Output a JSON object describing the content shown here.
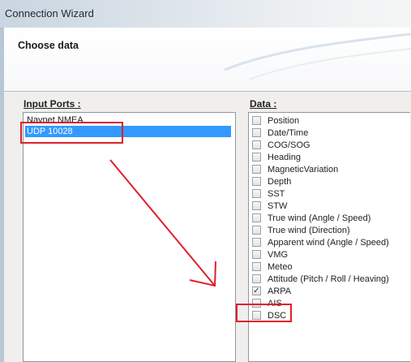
{
  "window": {
    "title": "Connection Wizard"
  },
  "header": {
    "title": "Choose data"
  },
  "ports": {
    "label": "Input Ports :",
    "items": [
      {
        "label": "Navnet NMEA",
        "selected": false
      },
      {
        "label": "UDP 10028",
        "selected": true
      }
    ]
  },
  "data_list": {
    "label": "Data :",
    "items": [
      {
        "label": "Position",
        "checked": false
      },
      {
        "label": "Date/Time",
        "checked": false
      },
      {
        "label": "COG/SOG",
        "checked": false
      },
      {
        "label": "Heading",
        "checked": false
      },
      {
        "label": "MagneticVariation",
        "checked": false
      },
      {
        "label": "Depth",
        "checked": false
      },
      {
        "label": "SST",
        "checked": false
      },
      {
        "label": "STW",
        "checked": false
      },
      {
        "label": "True wind (Angle / Speed)",
        "checked": false
      },
      {
        "label": "True wind (Direction)",
        "checked": false
      },
      {
        "label": "Apparent wind (Angle / Speed)",
        "checked": false
      },
      {
        "label": "VMG",
        "checked": false
      },
      {
        "label": "Meteo",
        "checked": false
      },
      {
        "label": "Attitude (Pitch / Roll / Heaving)",
        "checked": false
      },
      {
        "label": "ARPA",
        "checked": true
      },
      {
        "label": "AIS",
        "checked": false
      },
      {
        "label": "DSC",
        "checked": false
      }
    ]
  },
  "annotation_color": "#e01f2a",
  "selection_color": "#3399ff"
}
